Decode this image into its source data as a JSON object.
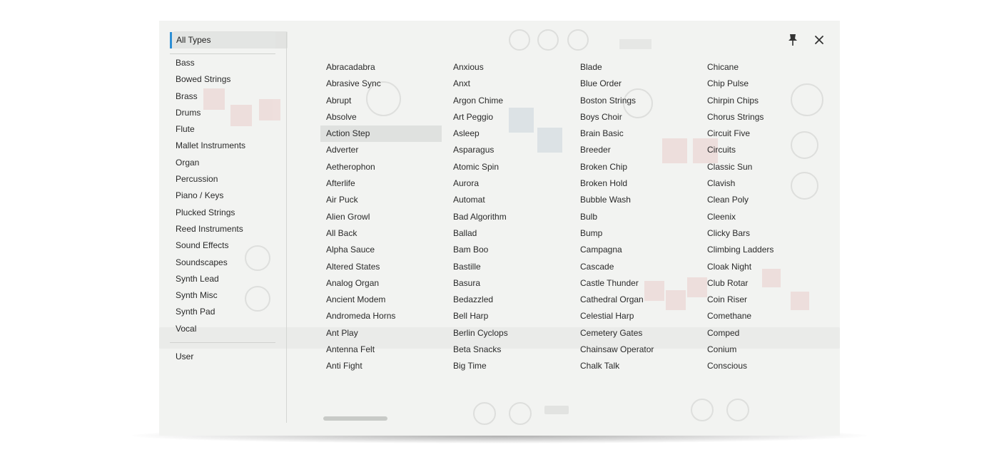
{
  "categories": {
    "all_label": "All Types",
    "items": [
      "Bass",
      "Bowed Strings",
      "Brass",
      "Drums",
      "Flute",
      "Mallet Instruments",
      "Organ",
      "Percussion",
      "Piano / Keys",
      "Plucked Strings",
      "Reed Instruments",
      "Sound Effects",
      "Soundscapes",
      "Synth Lead",
      "Synth Misc",
      "Synth Pad",
      "Vocal"
    ],
    "user_label": "User"
  },
  "presets": {
    "selected": "Action Step",
    "columns": [
      [
        "Abracadabra",
        "Abrasive Sync",
        "Abrupt",
        "Absolve",
        "Action Step",
        "Adverter",
        "Aetherophon",
        "Afterlife",
        "Air Puck",
        "Alien Growl",
        "All Back",
        "Alpha Sauce",
        "Altered States",
        "Analog Organ",
        "Ancient Modem",
        "Andromeda Horns",
        "Ant Play",
        "Antenna Felt",
        "Anti Fight"
      ],
      [
        "Anxious",
        "Anxt",
        "Argon Chime",
        "Art Peggio",
        "Asleep",
        "Asparagus",
        "Atomic Spin",
        "Aurora",
        "Automat",
        "Bad Algorithm",
        "Ballad",
        "Bam Boo",
        "Bastille",
        "Basura",
        "Bedazzled",
        "Bell Harp",
        "Berlin Cyclops",
        "Beta Snacks",
        "Big Time"
      ],
      [
        "Blade",
        "Blue Order",
        "Boston Strings",
        "Boys Choir",
        "Brain Basic",
        "Breeder",
        "Broken Chip",
        "Broken Hold",
        "Bubble Wash",
        "Bulb",
        "Bump",
        "Campagna",
        "Cascade",
        "Castle Thunder",
        "Cathedral Organ",
        "Celestial Harp",
        "Cemetery Gates",
        "Chainsaw Operator",
        "Chalk Talk"
      ],
      [
        "Chicane",
        "Chip Pulse",
        "Chirpin Chips",
        "Chorus Strings",
        "Circuit Five",
        "Circuits",
        "Classic Sun",
        "Clavish",
        "Clean Poly",
        "Cleenix",
        "Clicky Bars",
        "Climbing Ladders",
        "Cloak Night",
        "Club Rotar",
        "Coin Riser",
        "Comethane",
        "Comped",
        "Conium",
        "Conscious"
      ]
    ]
  },
  "colors": {
    "accent": "#2d8fd5",
    "panel": "#f2f3f1",
    "selected_row": "#dfe1df"
  },
  "icons": {
    "pin": "pin-icon",
    "close": "close-icon"
  }
}
